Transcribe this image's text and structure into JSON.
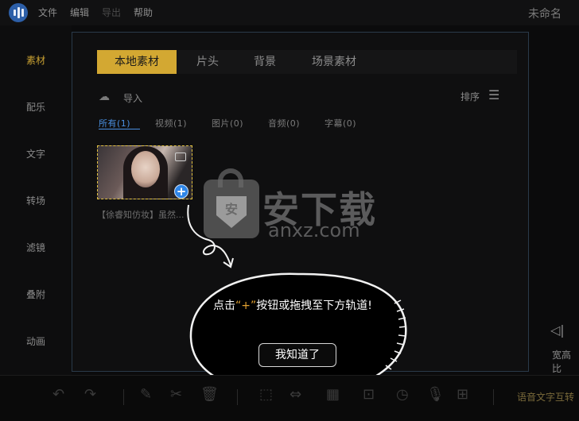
{
  "menu": {
    "file": "文件",
    "edit": "编辑",
    "export": "导出",
    "help": "帮助"
  },
  "doc_title": "未命名",
  "left_nav": [
    "素材",
    "配乐",
    "文字",
    "转场",
    "滤镜",
    "叠附",
    "动画"
  ],
  "tabs": [
    "本地素材",
    "片头",
    "背景",
    "场景素材"
  ],
  "import_label": "导入",
  "sort_label": "排序",
  "filters": [
    "所有(1)",
    "视频(1)",
    "图片(0)",
    "音频(0)",
    "字幕(0)"
  ],
  "thumb_caption": "【徐睿知仿妆】虽然...",
  "watermark": {
    "cn": "安下载",
    "url": "anxz.com",
    "shield": "安"
  },
  "tip": {
    "line_prefix": "点击",
    "plus": "“+”",
    "line_suffix": "按钮或拖拽至下方轨道!",
    "button": "我知道了"
  },
  "right_label": "宽高比",
  "toolbar_label": "语音文字互转",
  "icons": {
    "logo": "app-logo-icon",
    "import": "import-icon",
    "sort": "sort-icon",
    "add": "plus-icon",
    "undo": "undo-icon",
    "redo": "redo-icon"
  }
}
